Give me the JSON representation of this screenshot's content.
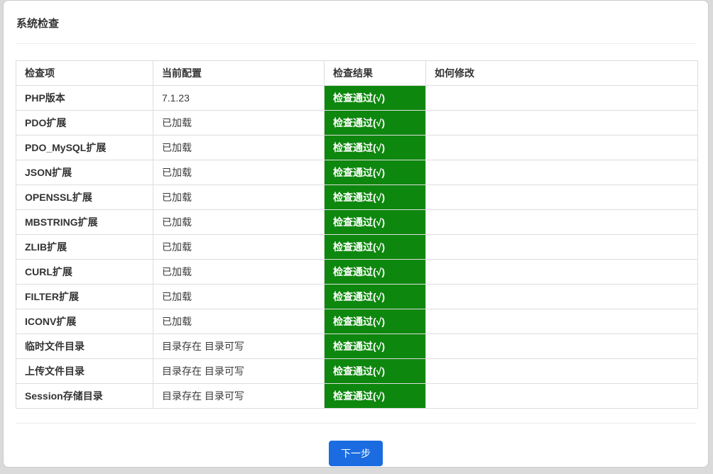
{
  "page": {
    "title": "系统检查"
  },
  "table": {
    "headers": {
      "item": "检查项",
      "config": "当前配置",
      "result": "检查结果",
      "fix": "如何修改"
    },
    "rows": [
      {
        "item": "PHP版本",
        "config": "7.1.23",
        "result": "检查通过(√)",
        "fix": ""
      },
      {
        "item": "PDO扩展",
        "config": "已加载",
        "result": "检查通过(√)",
        "fix": ""
      },
      {
        "item": "PDO_MySQL扩展",
        "config": "已加载",
        "result": "检查通过(√)",
        "fix": ""
      },
      {
        "item": "JSON扩展",
        "config": "已加载",
        "result": "检查通过(√)",
        "fix": ""
      },
      {
        "item": "OPENSSL扩展",
        "config": "已加载",
        "result": "检查通过(√)",
        "fix": ""
      },
      {
        "item": "MBSTRING扩展",
        "config": "已加载",
        "result": "检查通过(√)",
        "fix": ""
      },
      {
        "item": "ZLIB扩展",
        "config": "已加载",
        "result": "检查通过(√)",
        "fix": ""
      },
      {
        "item": "CURL扩展",
        "config": "已加载",
        "result": "检查通过(√)",
        "fix": ""
      },
      {
        "item": "FILTER扩展",
        "config": "已加载",
        "result": "检查通过(√)",
        "fix": ""
      },
      {
        "item": "ICONV扩展",
        "config": "已加载",
        "result": "检查通过(√)",
        "fix": ""
      },
      {
        "item": "临时文件目录",
        "config": "目录存在 目录可写",
        "result": "检查通过(√)",
        "fix": ""
      },
      {
        "item": "上传文件目录",
        "config": "目录存在 目录可写",
        "result": "检查通过(√)",
        "fix": ""
      },
      {
        "item": "Session存储目录",
        "config": "目录存在 目录可写",
        "result": "检查通过(√)",
        "fix": ""
      }
    ]
  },
  "footer": {
    "next_label": "下一步"
  },
  "colors": {
    "pass_green": "#0e870e",
    "primary_blue": "#1a6ce0"
  }
}
